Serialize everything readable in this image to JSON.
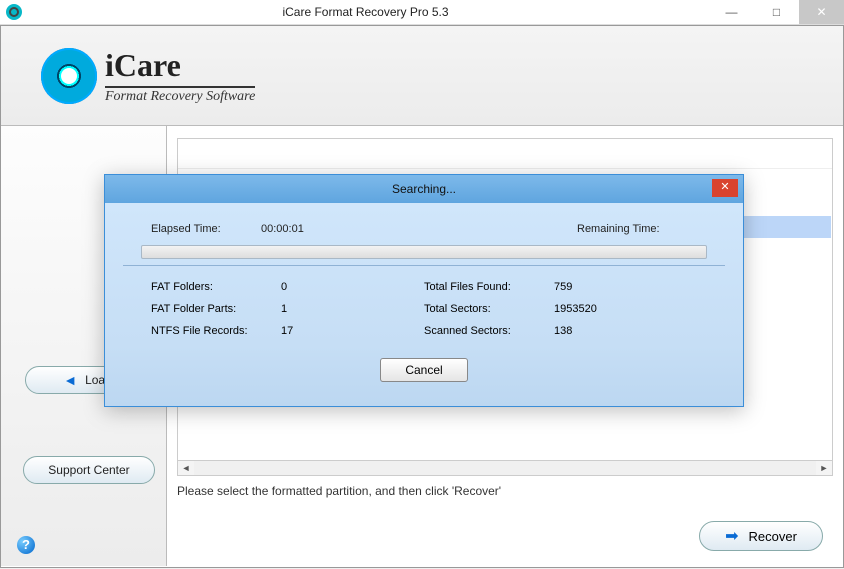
{
  "window": {
    "title": "iCare Format Recovery Pro 5.3",
    "minimize": "—",
    "maximize": "□",
    "close": "✕"
  },
  "logo": {
    "brand": "iCare",
    "sub": "Format Recovery Software"
  },
  "sidebar": {
    "load": "Load",
    "support": "Support Center"
  },
  "main": {
    "instruction": "Please select the formatted partition, and then click 'Recover'",
    "recover": "Recover"
  },
  "dialog": {
    "title": "Searching...",
    "close": "✕",
    "elapsed_label": "Elapsed Time:",
    "elapsed_value": "00:00:01",
    "remaining_label": "Remaining Time:",
    "remaining_value": "",
    "left": [
      {
        "label": "FAT Folders:",
        "value": "0"
      },
      {
        "label": "FAT Folder Parts:",
        "value": "1"
      },
      {
        "label": "NTFS File Records:",
        "value": "17"
      }
    ],
    "right": [
      {
        "label": "Total Files Found:",
        "value": "759"
      },
      {
        "label": "Total Sectors:",
        "value": "1953520"
      },
      {
        "label": "Scanned Sectors:",
        "value": "138"
      }
    ],
    "cancel": "Cancel"
  }
}
